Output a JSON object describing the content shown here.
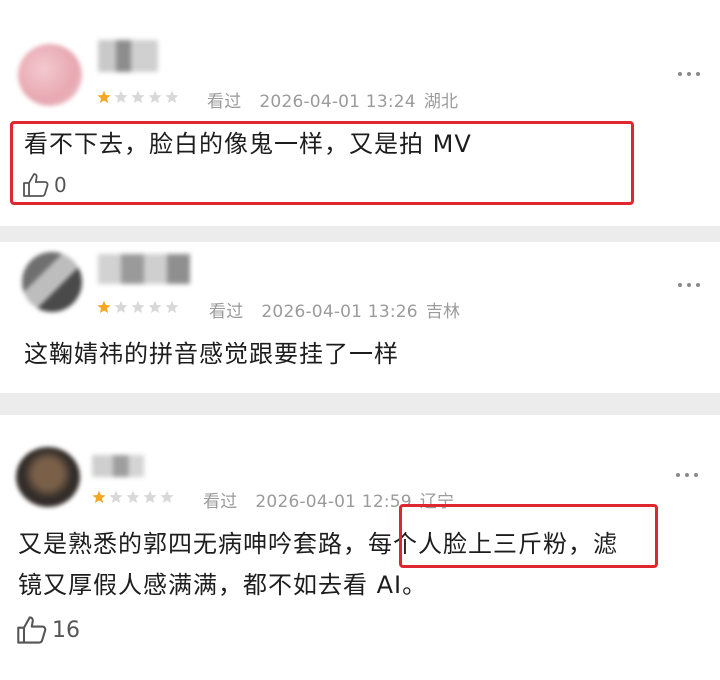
{
  "comments": [
    {
      "rating": 1,
      "watched": "看过",
      "datetime": "2026-04-01 13:24",
      "location": "湖北",
      "text": "看不下去，脸白的像鬼一样，又是拍 MV",
      "likes": "0"
    },
    {
      "rating": 1,
      "watched": "看过",
      "datetime": "2026-04-01 13:26",
      "location": "吉林",
      "text": "这鞠婧祎的拼音感觉跟要挂了一样"
    },
    {
      "rating": 1,
      "watched": "看过",
      "datetime": "2026-04-01 12:59",
      "location": "辽宁",
      "text_line1_pre": "又是熟悉的郭四无病呻吟套路，",
      "text_line1_highlight": "每个人脸上三斤粉，",
      "text_line1_post": "滤",
      "text_line2": "镜又厚假人感满满，都不如去看 AI。",
      "likes": "16"
    }
  ],
  "colors": {
    "highlight_box": "#e0262f",
    "star_filled": "#f5a623",
    "star_empty": "#d8d8d8",
    "meta_text": "#9b9b9b"
  },
  "icons": {
    "like": "thumbs-up-icon",
    "more": "more-dots-icon",
    "star": "star-icon"
  }
}
